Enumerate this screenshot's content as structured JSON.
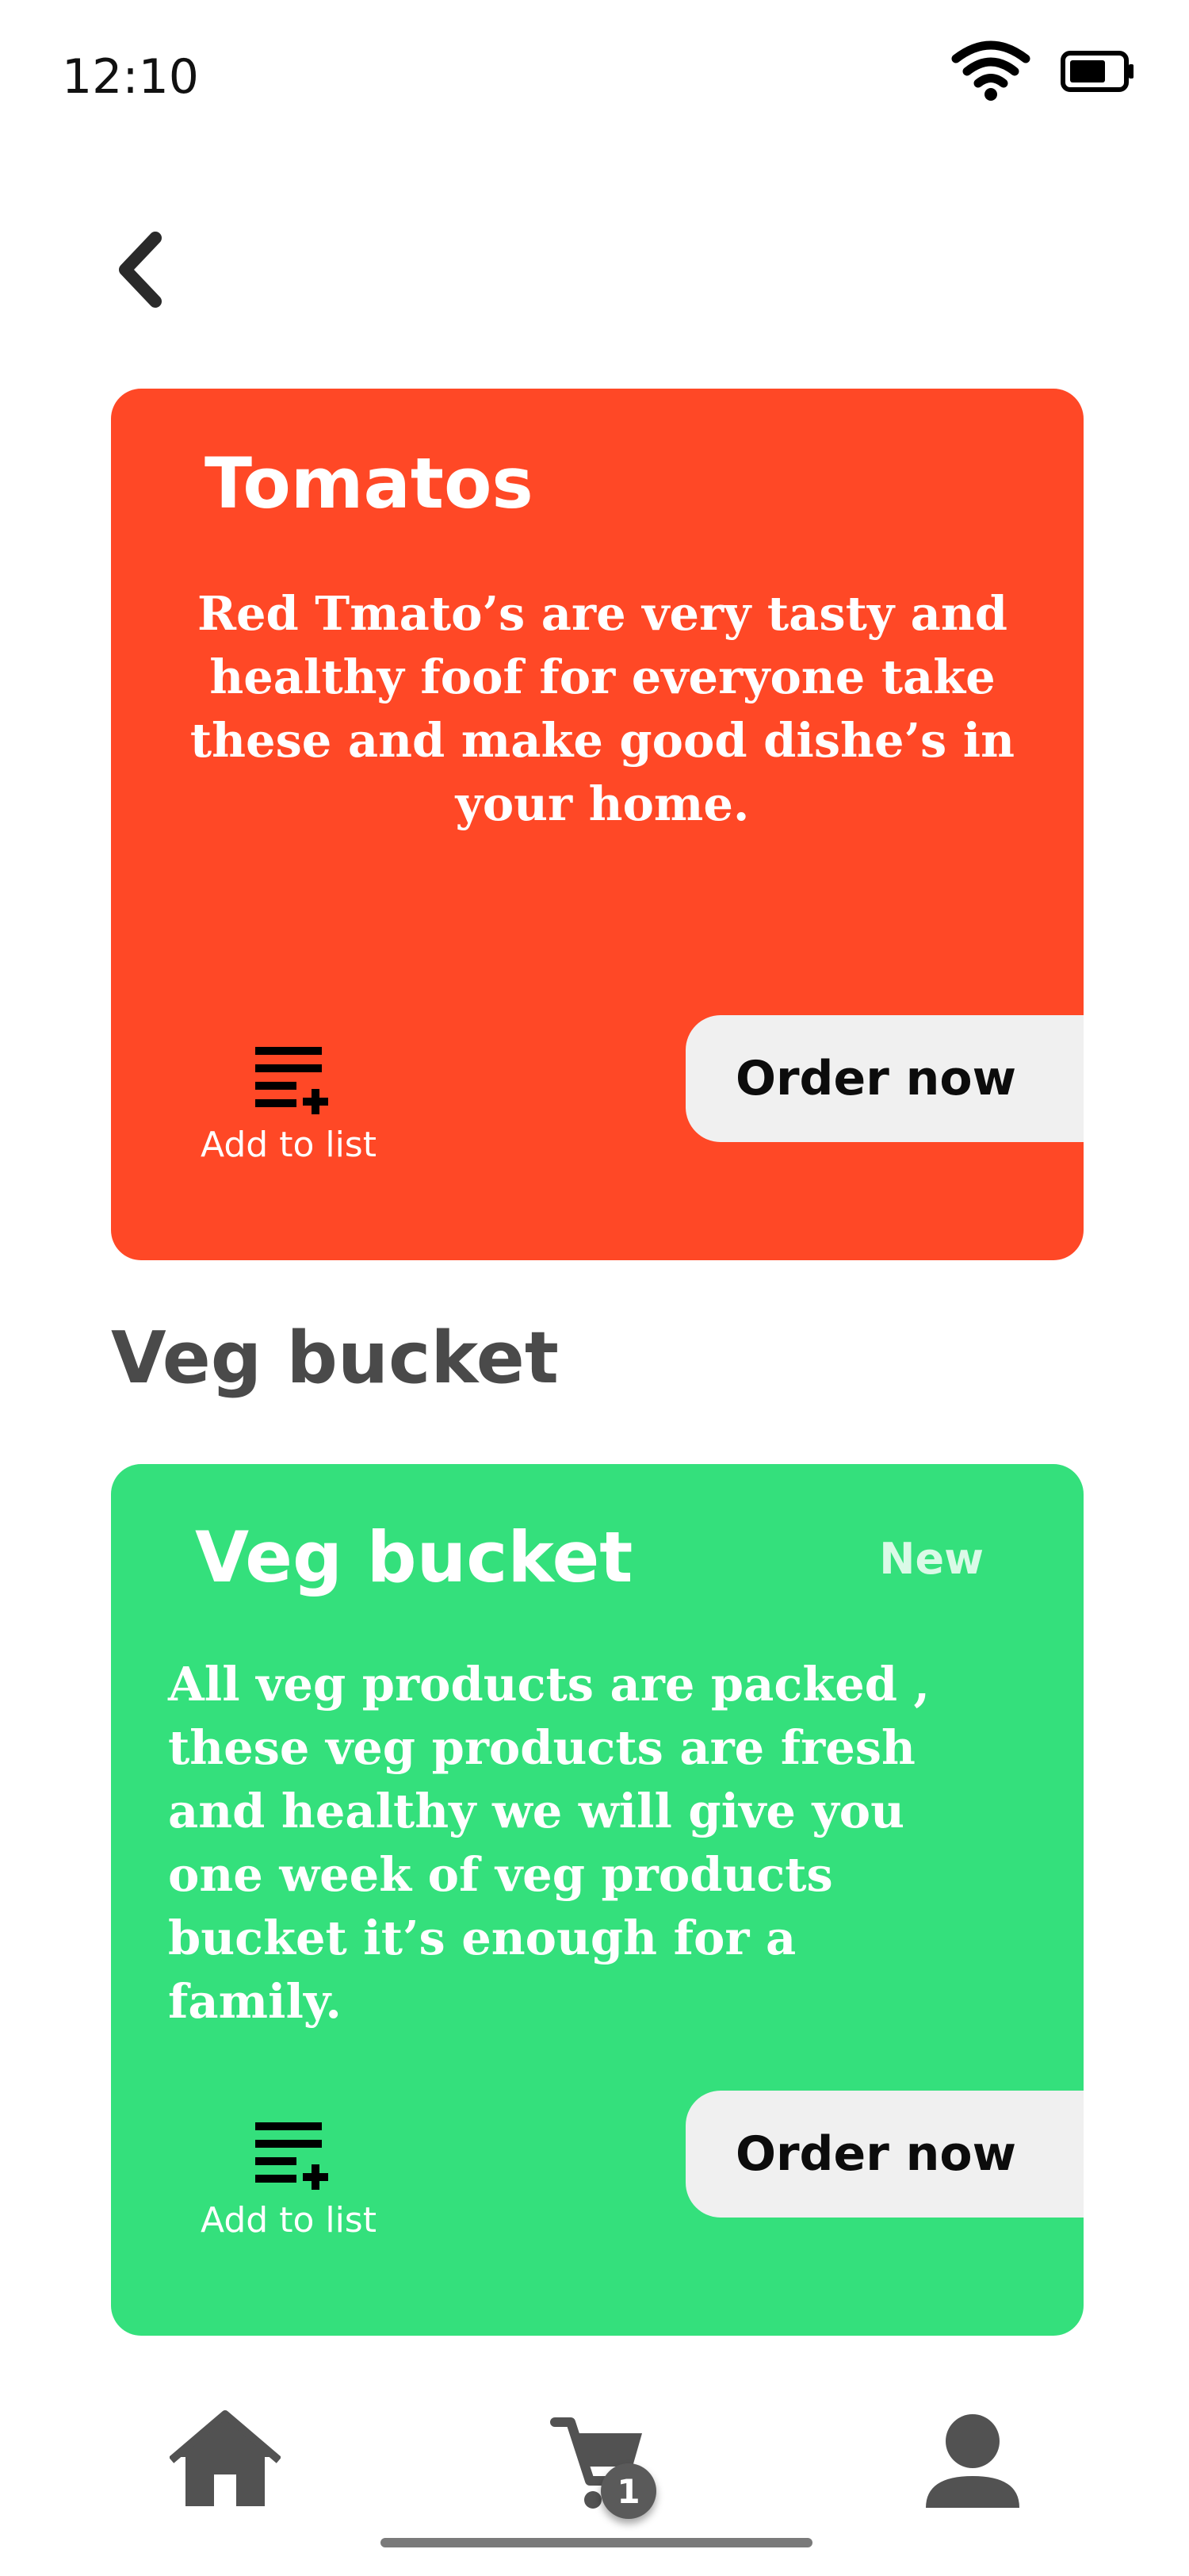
{
  "status_bar": {
    "time": "12:10",
    "wifi_icon": "wifi-icon",
    "battery_icon": "battery-icon"
  },
  "nav": {
    "back_icon": "chevron-left-icon"
  },
  "cards": [
    {
      "title": "Tomatos",
      "description": "Red Tmato’s are very tasty and healthy foof for everyone take these and make good dishe’s in your home.",
      "add_to_list_label": "Add to list",
      "add_to_list_icon": "playlist-add-icon",
      "order_label": "Order now",
      "color": "#ff4826"
    },
    {
      "title": "Veg bucket",
      "badge": "New",
      "description": "All veg products are packed , these veg products are fresh and healthy we will give you one week of veg products bucket it’s enough for a family.",
      "add_to_list_label": "Add to list",
      "add_to_list_icon": "playlist-add-icon",
      "order_label": "Order now",
      "color": "#34e07c"
    }
  ],
  "section_heading": "Veg bucket",
  "bottom_nav": {
    "items": [
      {
        "icon": "home-icon"
      },
      {
        "icon": "cart-icon",
        "badge": "1"
      },
      {
        "icon": "person-icon"
      }
    ]
  },
  "colors": {
    "accent_red": "#ff4826",
    "accent_green": "#34e07c",
    "heading_gray": "#4a4a4a",
    "button_bg": "#f0f0f0"
  }
}
